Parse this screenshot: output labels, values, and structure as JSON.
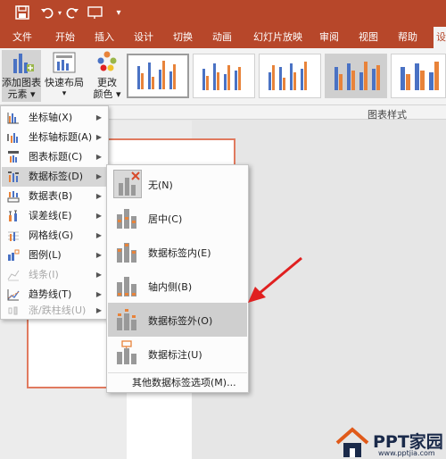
{
  "quick_access": {
    "save_icon": "save-icon",
    "undo_icon": "undo-icon",
    "redo_icon": "redo-icon",
    "start_icon": "present-from-start-icon",
    "customize_icon": "customize-qat-icon"
  },
  "tabs": [
    "文件",
    "开始",
    "插入",
    "设计",
    "切换",
    "动画",
    "幻灯片放映",
    "审阅",
    "视图",
    "帮助",
    "设"
  ],
  "ribbon": {
    "add_element_label_1": "添加图表",
    "add_element_label_2": "元素",
    "quick_layout_label": "快速布局",
    "change_colors_label_1": "更改",
    "change_colors_label_2": "颜色",
    "chart_styles_group": "图表样式"
  },
  "menu1": {
    "items": [
      {
        "label": "坐标轴(X)",
        "icon": "axes-icon"
      },
      {
        "label": "坐标轴标题(A)",
        "icon": "axis-titles-icon"
      },
      {
        "label": "图表标题(C)",
        "icon": "chart-title-icon"
      },
      {
        "label": "数据标签(D)",
        "icon": "data-labels-icon"
      },
      {
        "label": "数据表(B)",
        "icon": "data-table-icon"
      },
      {
        "label": "误差线(E)",
        "icon": "error-bars-icon"
      },
      {
        "label": "网格线(G)",
        "icon": "gridlines-icon"
      },
      {
        "label": "图例(L)",
        "icon": "legend-icon"
      },
      {
        "label": "线条(I)",
        "icon": "lines-icon"
      },
      {
        "label": "趋势线(T)",
        "icon": "trendline-icon"
      },
      {
        "label": "涨/跌柱线(U)",
        "icon": "up-down-bars-icon"
      }
    ]
  },
  "menu2": {
    "items": [
      {
        "label": "无(N)",
        "icon": "data-labels-none-icon"
      },
      {
        "label": "居中(C)",
        "icon": "data-labels-center-icon"
      },
      {
        "label": "数据标签内(E)",
        "icon": "data-labels-inside-end-icon"
      },
      {
        "label": "轴内侧(B)",
        "icon": "data-labels-inside-base-icon"
      },
      {
        "label": "数据标签外(O)",
        "icon": "data-labels-outside-end-icon"
      },
      {
        "label": "数据标注(U)",
        "icon": "data-callout-icon"
      }
    ],
    "more_options": "其他数据标签选项(M)..."
  },
  "watermark": {
    "brand": "PPT家园",
    "url": "www.pptjia.com"
  },
  "colors": {
    "title_bar": "#b7472a",
    "ribbon_bg": "#f3f3f3",
    "accent_blue": "#4a72c4",
    "accent_orange": "#e8833a",
    "arrow_red": "#e02020"
  }
}
